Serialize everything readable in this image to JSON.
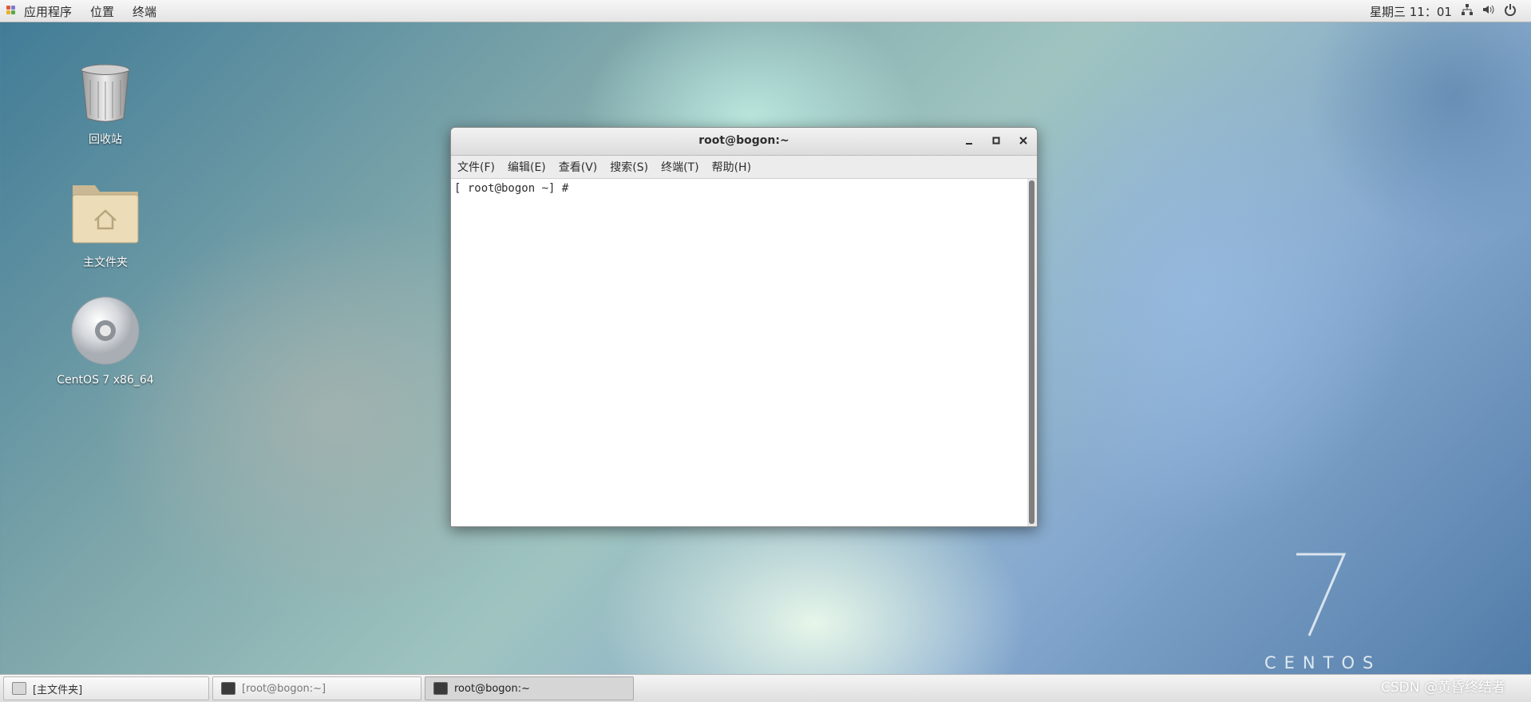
{
  "topbar": {
    "applications": "应用程序",
    "places": "位置",
    "terminal_menu": "终端",
    "clock": "星期三 11：01"
  },
  "desktop": {
    "icons": [
      {
        "label": "回收站",
        "icon": "trash-icon"
      },
      {
        "label": "主文件夹",
        "icon": "home-folder-icon"
      },
      {
        "label": "CentOS 7 x86_64",
        "icon": "disc-icon"
      }
    ],
    "logo_text": "CENTOS",
    "logo_number": "7"
  },
  "window": {
    "title": "root@bogon:~",
    "menu": [
      "文件(F)",
      "编辑(E)",
      "查看(V)",
      "搜索(S)",
      "终端(T)",
      "帮助(H)"
    ],
    "prompt": "[ root@bogon ~] #"
  },
  "taskbar": {
    "tasks": [
      {
        "label": "[主文件夹]",
        "icon": "folder-icon"
      },
      {
        "label": "[root@bogon:~]",
        "icon": "terminal-icon"
      },
      {
        "label": "root@bogon:~",
        "icon": "terminal-icon"
      }
    ]
  },
  "watermark": "CSDN @黄昏终结者"
}
